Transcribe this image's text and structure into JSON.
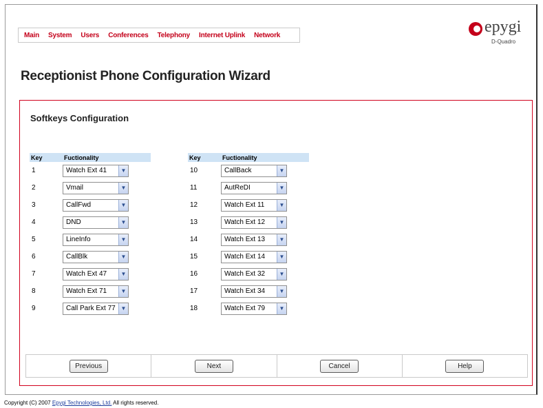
{
  "nav": {
    "items": [
      "Main",
      "System",
      "Users",
      "Conferences",
      "Telephony",
      "Internet Uplink",
      "Network"
    ]
  },
  "logo": {
    "word": "epygi",
    "sub": "D-Quadro"
  },
  "page": {
    "title": "Receptionist Phone Configuration Wizard"
  },
  "section": {
    "title": "Softkeys Configuration"
  },
  "table": {
    "col_key": "Key",
    "col_func": "Fuctionality",
    "left": [
      {
        "key": "1",
        "value": "Watch Ext 41"
      },
      {
        "key": "2",
        "value": "Vmail"
      },
      {
        "key": "3",
        "value": "CallFwd"
      },
      {
        "key": "4",
        "value": "DND"
      },
      {
        "key": "5",
        "value": "LineInfo"
      },
      {
        "key": "6",
        "value": "CallBlk"
      },
      {
        "key": "7",
        "value": "Watch Ext 47"
      },
      {
        "key": "8",
        "value": "Watch Ext 71"
      },
      {
        "key": "9",
        "value": "Call Park Ext 77"
      }
    ],
    "right": [
      {
        "key": "10",
        "value": "CallBack"
      },
      {
        "key": "11",
        "value": "AutReDI"
      },
      {
        "key": "12",
        "value": "Watch Ext 11"
      },
      {
        "key": "13",
        "value": "Watch Ext 12"
      },
      {
        "key": "14",
        "value": "Watch Ext 13"
      },
      {
        "key": "15",
        "value": "Watch Ext 14"
      },
      {
        "key": "16",
        "value": "Watch Ext 32"
      },
      {
        "key": "17",
        "value": "Watch Ext 34"
      },
      {
        "key": "18",
        "value": "Watch Ext 79"
      }
    ]
  },
  "buttons": {
    "previous": "Previous",
    "next": "Next",
    "cancel": "Cancel",
    "help": "Help"
  },
  "footer": {
    "prefix": "Copyright (C) 2007 ",
    "link": "Epygi Technologies, Ltd.",
    "suffix": " All rights reserved."
  },
  "colors": {
    "accent": "#c4001a",
    "header_bg": "#cfe3f5",
    "border": "#d0001c"
  }
}
